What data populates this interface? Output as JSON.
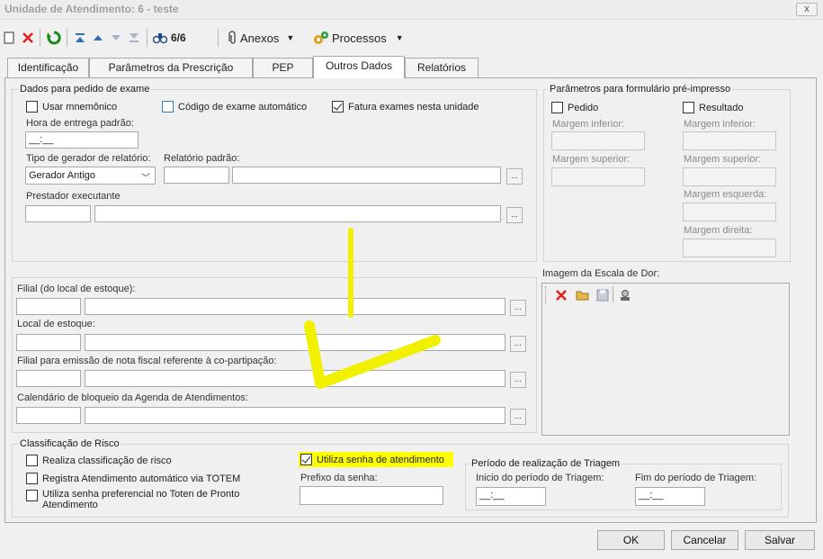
{
  "window": {
    "title": "Unidade de Atendimento: 6 - teste",
    "close_label": "x"
  },
  "toolbar": {
    "record_counter": "6/6",
    "attachments_label": "Anexos",
    "processes_label": "Processos"
  },
  "tabs": [
    "Identificação",
    "Parâmetros da Prescrição",
    "PEP",
    "Outros Dados",
    "Relatórios"
  ],
  "active_tab": "Outros Dados",
  "exam": {
    "legend": "Dados para pedido de exame",
    "use_mnemonic": {
      "label": "Usar mnemônico",
      "checked": false
    },
    "auto_code": {
      "label": "Código de exame automático",
      "checked": false
    },
    "bill_here": {
      "label": "Fatura exames nesta unidade",
      "checked": true
    },
    "delivery_time_label": "Hora de entrega padrão:",
    "delivery_time_value": "__:__",
    "generator_type_label": "Tipo de gerador de relatório:",
    "generator_type_value": "Gerador Antigo",
    "default_report_label": "Relatório padrão:",
    "provider_label": "Prestador executante"
  },
  "preprint": {
    "legend": "Parâmetros para formulário pré-impresso",
    "pedido": {
      "label": "Pedido",
      "checked": false
    },
    "resultado": {
      "label": "Resultado",
      "checked": false
    },
    "bottom_margin_label": "Margem inferior:",
    "top_margin_label": "Margem superior:",
    "left_margin_label": "Margem esquerda:",
    "right_margin_label": "Margem direita:"
  },
  "stock": {
    "branch_label": "Filial (do local de estoque):",
    "location_label": "Local de estoque:",
    "invoice_branch_label": "Filial para emissão de nota fiscal referente à co-partipação:",
    "calendar_label": "Calendário de bloqueio da Agenda de Atendimentos:",
    "lookup_label": "..."
  },
  "pain_scale": {
    "label": "Imagem da Escala de Dor:"
  },
  "risk": {
    "legend": "Classificação de Risco",
    "classify": {
      "label": "Realiza classificação de risco",
      "checked": false
    },
    "totem": {
      "label": "Registra Atendimento automático via TOTEM",
      "checked": false
    },
    "preferential": {
      "label": "Utiliza senha preferencial no Toten de Pronto Atendimento",
      "checked": false
    },
    "uses_password": {
      "label": "Utiliza senha de atendimento",
      "checked": true
    },
    "password_prefix_label": "Prefixo da senha:"
  },
  "triage": {
    "legend": "Período de realização de Triagem",
    "start_label": "Inicio do período de Triagem:",
    "start_value": "__:__",
    "end_label": "Fim do período de Triagem:",
    "end_value": "__:__"
  },
  "buttons": {
    "ok": "OK",
    "cancel": "Cancelar",
    "save": "Salvar"
  },
  "colors": {
    "highlight": "#ffff00",
    "delete_red": "#e02020",
    "annotation": "#f0f000"
  }
}
